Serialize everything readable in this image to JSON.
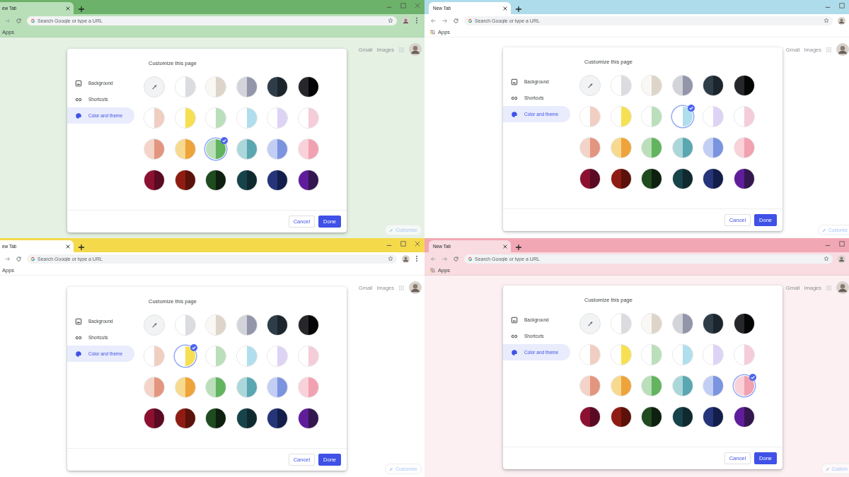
{
  "windows": [
    {
      "tab_title": "ew Tab",
      "omnibox": {
        "placeholder": "Search Google or type a URL"
      },
      "bookmark": {
        "label": "Apps",
        "kind": "plain"
      },
      "header_links": [
        "Gmail",
        "Images"
      ],
      "dialog": {
        "title": "Customize this page",
        "menu": [
          {
            "label": "Background",
            "kind": "background",
            "selected": false
          },
          {
            "label": "Shortcuts",
            "kind": "shortcuts",
            "selected": false
          },
          {
            "label": "Color and theme",
            "kind": "theme",
            "selected": true
          }
        ],
        "swatches": [
          {
            "kind": "picker",
            "color": "#f1f3f4",
            "selected": false
          },
          {
            "kind": "split",
            "halves": [
              {
                "color": "#ffffff"
              },
              {
                "color": "#dadce0"
              }
            ],
            "selected": false
          },
          {
            "kind": "split",
            "halves": [
              {
                "color": "#faf8f5"
              },
              {
                "color": "#ddd5c9"
              }
            ],
            "selected": false
          },
          {
            "kind": "split",
            "halves": [
              {
                "color": "#d3d4d9"
              },
              {
                "color": "#9395aa"
              }
            ],
            "selected": false
          },
          {
            "kind": "split",
            "halves": [
              {
                "color": "#2f3d48"
              },
              {
                "color": "#1c252c"
              }
            ],
            "selected": false
          },
          {
            "kind": "split",
            "halves": [
              {
                "color": "#26272a"
              },
              {
                "color": "#050505"
              }
            ],
            "selected": false
          },
          {
            "kind": "split",
            "halves": [
              {
                "color": "#ffffff"
              },
              {
                "color": "#f0cfc2"
              }
            ],
            "selected": false
          },
          {
            "kind": "split",
            "halves": [
              {
                "color": "#ffffff"
              },
              {
                "color": "#f6e052"
              }
            ],
            "selected": false
          },
          {
            "kind": "split",
            "halves": [
              {
                "color": "#ffffff"
              },
              {
                "color": "#badfba"
              }
            ],
            "selected": false
          },
          {
            "kind": "split",
            "halves": [
              {
                "color": "#ffffff"
              },
              {
                "color": "#b0deec"
              }
            ],
            "selected": false
          },
          {
            "kind": "split",
            "halves": [
              {
                "color": "#ffffff"
              },
              {
                "color": "#ddd3f5"
              }
            ],
            "selected": false
          },
          {
            "kind": "split",
            "halves": [
              {
                "color": "#ffffff"
              },
              {
                "color": "#f4cdd9"
              }
            ],
            "selected": false
          },
          {
            "kind": "split",
            "halves": [
              {
                "color": "#f4d4c8"
              },
              {
                "color": "#e3967f"
              }
            ],
            "selected": false
          },
          {
            "kind": "split",
            "halves": [
              {
                "color": "#f7da90"
              },
              {
                "color": "#eea33b"
              }
            ],
            "selected": false
          },
          {
            "kind": "split",
            "halves": [
              {
                "color": "#badfba"
              },
              {
                "color": "#62b45f"
              }
            ],
            "selected": true
          },
          {
            "kind": "split",
            "halves": [
              {
                "color": "#abd7da"
              },
              {
                "color": "#5ba7b1"
              }
            ],
            "selected": false
          },
          {
            "kind": "split",
            "halves": [
              {
                "color": "#c2cef4"
              },
              {
                "color": "#7b94df"
              }
            ],
            "selected": false
          },
          {
            "kind": "split",
            "halves": [
              {
                "color": "#f9d1d9"
              },
              {
                "color": "#f1a1b1"
              }
            ],
            "selected": false
          },
          {
            "kind": "split",
            "halves": [
              {
                "color": "#8c1131"
              },
              {
                "color": "#5b0a23"
              }
            ],
            "selected": false
          },
          {
            "kind": "split",
            "halves": [
              {
                "color": "#8f1c13"
              },
              {
                "color": "#5b120a"
              }
            ],
            "selected": false
          },
          {
            "kind": "split",
            "halves": [
              {
                "color": "#1f4b1f"
              },
              {
                "color": "#0e200f"
              }
            ],
            "selected": false
          },
          {
            "kind": "split",
            "halves": [
              {
                "color": "#17434a"
              },
              {
                "color": "#10292e"
              }
            ],
            "selected": false
          },
          {
            "kind": "split",
            "halves": [
              {
                "color": "#26357a"
              },
              {
                "color": "#131e4b"
              }
            ],
            "selected": false
          },
          {
            "kind": "split",
            "halves": [
              {
                "color": "#5f1d9b"
              },
              {
                "color": "#351750"
              }
            ],
            "selected": false
          }
        ],
        "buttons": [
          {
            "label": "Cancel",
            "kind": "secondary"
          },
          {
            "label": "Done",
            "kind": "primary"
          }
        ]
      },
      "customize_button": "Customize"
    },
    {
      "tab_title": "New Tab",
      "omnibox": {
        "placeholder": "Search Google or type a URL"
      },
      "bookmark": {
        "label": "Apps",
        "kind": "apps_icon"
      },
      "header_links": [
        "Gmail",
        "Images"
      ],
      "dialog": {
        "title": "Customize this page",
        "menu": [
          {
            "label": "Background",
            "kind": "background",
            "selected": false
          },
          {
            "label": "Shortcuts",
            "kind": "shortcuts",
            "selected": false
          },
          {
            "label": "Color and theme",
            "kind": "theme",
            "selected": true
          }
        ],
        "swatches": [
          {
            "kind": "picker",
            "color": "#f1f3f4",
            "selected": false
          },
          {
            "kind": "split",
            "halves": [
              {
                "color": "#ffffff"
              },
              {
                "color": "#dadce0"
              }
            ],
            "selected": false
          },
          {
            "kind": "split",
            "halves": [
              {
                "color": "#faf8f5"
              },
              {
                "color": "#ddd5c9"
              }
            ],
            "selected": false
          },
          {
            "kind": "split",
            "halves": [
              {
                "color": "#d3d4d9"
              },
              {
                "color": "#9395aa"
              }
            ],
            "selected": false
          },
          {
            "kind": "split",
            "halves": [
              {
                "color": "#2f3d48"
              },
              {
                "color": "#1c252c"
              }
            ],
            "selected": false
          },
          {
            "kind": "split",
            "halves": [
              {
                "color": "#26272a"
              },
              {
                "color": "#050505"
              }
            ],
            "selected": false
          },
          {
            "kind": "split",
            "halves": [
              {
                "color": "#ffffff"
              },
              {
                "color": "#f0cfc2"
              }
            ],
            "selected": false
          },
          {
            "kind": "split",
            "halves": [
              {
                "color": "#ffffff"
              },
              {
                "color": "#f6e052"
              }
            ],
            "selected": false
          },
          {
            "kind": "split",
            "halves": [
              {
                "color": "#ffffff"
              },
              {
                "color": "#badfba"
              }
            ],
            "selected": false
          },
          {
            "kind": "split",
            "halves": [
              {
                "color": "#ffffff"
              },
              {
                "color": "#b0deec"
              }
            ],
            "selected": true
          },
          {
            "kind": "split",
            "halves": [
              {
                "color": "#ffffff"
              },
              {
                "color": "#ddd3f5"
              }
            ],
            "selected": false
          },
          {
            "kind": "split",
            "halves": [
              {
                "color": "#ffffff"
              },
              {
                "color": "#f4cdd9"
              }
            ],
            "selected": false
          },
          {
            "kind": "split",
            "halves": [
              {
                "color": "#f4d4c8"
              },
              {
                "color": "#e3967f"
              }
            ],
            "selected": false
          },
          {
            "kind": "split",
            "halves": [
              {
                "color": "#f7da90"
              },
              {
                "color": "#eea33b"
              }
            ],
            "selected": false
          },
          {
            "kind": "split",
            "halves": [
              {
                "color": "#badfba"
              },
              {
                "color": "#62b45f"
              }
            ],
            "selected": false
          },
          {
            "kind": "split",
            "halves": [
              {
                "color": "#abd7da"
              },
              {
                "color": "#5ba7b1"
              }
            ],
            "selected": false
          },
          {
            "kind": "split",
            "halves": [
              {
                "color": "#c2cef4"
              },
              {
                "color": "#7b94df"
              }
            ],
            "selected": false
          },
          {
            "kind": "split",
            "halves": [
              {
                "color": "#f9d1d9"
              },
              {
                "color": "#f1a1b1"
              }
            ],
            "selected": false
          },
          {
            "kind": "split",
            "halves": [
              {
                "color": "#8c1131"
              },
              {
                "color": "#5b0a23"
              }
            ],
            "selected": false
          },
          {
            "kind": "split",
            "halves": [
              {
                "color": "#8f1c13"
              },
              {
                "color": "#5b120a"
              }
            ],
            "selected": false
          },
          {
            "kind": "split",
            "halves": [
              {
                "color": "#1f4b1f"
              },
              {
                "color": "#0e200f"
              }
            ],
            "selected": false
          },
          {
            "kind": "split",
            "halves": [
              {
                "color": "#17434a"
              },
              {
                "color": "#10292e"
              }
            ],
            "selected": false
          },
          {
            "kind": "split",
            "halves": [
              {
                "color": "#26357a"
              },
              {
                "color": "#131e4b"
              }
            ],
            "selected": false
          },
          {
            "kind": "split",
            "halves": [
              {
                "color": "#5f1d9b"
              },
              {
                "color": "#351750"
              }
            ],
            "selected": false
          }
        ],
        "buttons": [
          {
            "label": "Cancel",
            "kind": "secondary"
          },
          {
            "label": "Done",
            "kind": "primary"
          }
        ]
      },
      "customize_button": "Customiz"
    },
    {
      "tab_title": "ew Tab",
      "omnibox": {
        "placeholder": "Search Google or type a URL"
      },
      "bookmark": {
        "label": "Apps",
        "kind": "plain"
      },
      "header_links": [
        "Gmail",
        "Images"
      ],
      "dialog": {
        "title": "Customize this page",
        "menu": [
          {
            "label": "Background",
            "kind": "background",
            "selected": false
          },
          {
            "label": "Shortcuts",
            "kind": "shortcuts",
            "selected": false
          },
          {
            "label": "Color and theme",
            "kind": "theme",
            "selected": true
          }
        ],
        "swatches": [
          {
            "kind": "picker",
            "color": "#f1f3f4",
            "selected": false
          },
          {
            "kind": "split",
            "halves": [
              {
                "color": "#ffffff"
              },
              {
                "color": "#dadce0"
              }
            ],
            "selected": false
          },
          {
            "kind": "split",
            "halves": [
              {
                "color": "#faf8f5"
              },
              {
                "color": "#ddd5c9"
              }
            ],
            "selected": false
          },
          {
            "kind": "split",
            "halves": [
              {
                "color": "#d3d4d9"
              },
              {
                "color": "#9395aa"
              }
            ],
            "selected": false
          },
          {
            "kind": "split",
            "halves": [
              {
                "color": "#2f3d48"
              },
              {
                "color": "#1c252c"
              }
            ],
            "selected": false
          },
          {
            "kind": "split",
            "halves": [
              {
                "color": "#26272a"
              },
              {
                "color": "#050505"
              }
            ],
            "selected": false
          },
          {
            "kind": "split",
            "halves": [
              {
                "color": "#ffffff"
              },
              {
                "color": "#f0cfc2"
              }
            ],
            "selected": false
          },
          {
            "kind": "split",
            "halves": [
              {
                "color": "#ffffff"
              },
              {
                "color": "#f6e052"
              }
            ],
            "selected": true
          },
          {
            "kind": "split",
            "halves": [
              {
                "color": "#ffffff"
              },
              {
                "color": "#badfba"
              }
            ],
            "selected": false
          },
          {
            "kind": "split",
            "halves": [
              {
                "color": "#ffffff"
              },
              {
                "color": "#b0deec"
              }
            ],
            "selected": false
          },
          {
            "kind": "split",
            "halves": [
              {
                "color": "#ffffff"
              },
              {
                "color": "#ddd3f5"
              }
            ],
            "selected": false
          },
          {
            "kind": "split",
            "halves": [
              {
                "color": "#ffffff"
              },
              {
                "color": "#f4cdd9"
              }
            ],
            "selected": false
          },
          {
            "kind": "split",
            "halves": [
              {
                "color": "#f4d4c8"
              },
              {
                "color": "#e3967f"
              }
            ],
            "selected": false
          },
          {
            "kind": "split",
            "halves": [
              {
                "color": "#f7da90"
              },
              {
                "color": "#eea33b"
              }
            ],
            "selected": false
          },
          {
            "kind": "split",
            "halves": [
              {
                "color": "#badfba"
              },
              {
                "color": "#62b45f"
              }
            ],
            "selected": false
          },
          {
            "kind": "split",
            "halves": [
              {
                "color": "#abd7da"
              },
              {
                "color": "#5ba7b1"
              }
            ],
            "selected": false
          },
          {
            "kind": "split",
            "halves": [
              {
                "color": "#c2cef4"
              },
              {
                "color": "#7b94df"
              }
            ],
            "selected": false
          },
          {
            "kind": "split",
            "halves": [
              {
                "color": "#f9d1d9"
              },
              {
                "color": "#f1a1b1"
              }
            ],
            "selected": false
          },
          {
            "kind": "split",
            "halves": [
              {
                "color": "#8c1131"
              },
              {
                "color": "#5b0a23"
              }
            ],
            "selected": false
          },
          {
            "kind": "split",
            "halves": [
              {
                "color": "#8f1c13"
              },
              {
                "color": "#5b120a"
              }
            ],
            "selected": false
          },
          {
            "kind": "split",
            "halves": [
              {
                "color": "#1f4b1f"
              },
              {
                "color": "#0e200f"
              }
            ],
            "selected": false
          },
          {
            "kind": "split",
            "halves": [
              {
                "color": "#17434a"
              },
              {
                "color": "#10292e"
              }
            ],
            "selected": false
          },
          {
            "kind": "split",
            "halves": [
              {
                "color": "#26357a"
              },
              {
                "color": "#131e4b"
              }
            ],
            "selected": false
          },
          {
            "kind": "split",
            "halves": [
              {
                "color": "#5f1d9b"
              },
              {
                "color": "#351750"
              }
            ],
            "selected": false
          }
        ],
        "buttons": [
          {
            "label": "Cancel",
            "kind": "secondary"
          },
          {
            "label": "Done",
            "kind": "primary"
          }
        ]
      },
      "customize_button": "Customize"
    },
    {
      "tab_title": "New Tab",
      "omnibox": {
        "placeholder": "Search Google or type a URL"
      },
      "bookmark": {
        "label": "Apps",
        "kind": "apps_icon"
      },
      "header_links": [
        "Gmail",
        "Images"
      ],
      "dialog": {
        "title": "Customize this page",
        "menu": [
          {
            "label": "Background",
            "kind": "background",
            "selected": false
          },
          {
            "label": "Shortcuts",
            "kind": "shortcuts",
            "selected": false
          },
          {
            "label": "Color and theme",
            "kind": "theme",
            "selected": true
          }
        ],
        "swatches": [
          {
            "kind": "picker",
            "color": "#f1f3f4",
            "selected": false
          },
          {
            "kind": "split",
            "halves": [
              {
                "color": "#ffffff"
              },
              {
                "color": "#dadce0"
              }
            ],
            "selected": false
          },
          {
            "kind": "split",
            "halves": [
              {
                "color": "#faf8f5"
              },
              {
                "color": "#ddd5c9"
              }
            ],
            "selected": false
          },
          {
            "kind": "split",
            "halves": [
              {
                "color": "#d3d4d9"
              },
              {
                "color": "#9395aa"
              }
            ],
            "selected": false
          },
          {
            "kind": "split",
            "halves": [
              {
                "color": "#2f3d48"
              },
              {
                "color": "#1c252c"
              }
            ],
            "selected": false
          },
          {
            "kind": "split",
            "halves": [
              {
                "color": "#26272a"
              },
              {
                "color": "#050505"
              }
            ],
            "selected": false
          },
          {
            "kind": "split",
            "halves": [
              {
                "color": "#ffffff"
              },
              {
                "color": "#f0cfc2"
              }
            ],
            "selected": false
          },
          {
            "kind": "split",
            "halves": [
              {
                "color": "#ffffff"
              },
              {
                "color": "#f6e052"
              }
            ],
            "selected": false
          },
          {
            "kind": "split",
            "halves": [
              {
                "color": "#ffffff"
              },
              {
                "color": "#badfba"
              }
            ],
            "selected": false
          },
          {
            "kind": "split",
            "halves": [
              {
                "color": "#ffffff"
              },
              {
                "color": "#b0deec"
              }
            ],
            "selected": false
          },
          {
            "kind": "split",
            "halves": [
              {
                "color": "#ffffff"
              },
              {
                "color": "#ddd3f5"
              }
            ],
            "selected": false
          },
          {
            "kind": "split",
            "halves": [
              {
                "color": "#ffffff"
              },
              {
                "color": "#f4cdd9"
              }
            ],
            "selected": false
          },
          {
            "kind": "split",
            "halves": [
              {
                "color": "#f4d4c8"
              },
              {
                "color": "#e3967f"
              }
            ],
            "selected": false
          },
          {
            "kind": "split",
            "halves": [
              {
                "color": "#f7da90"
              },
              {
                "color": "#eea33b"
              }
            ],
            "selected": false
          },
          {
            "kind": "split",
            "halves": [
              {
                "color": "#badfba"
              },
              {
                "color": "#62b45f"
              }
            ],
            "selected": false
          },
          {
            "kind": "split",
            "halves": [
              {
                "color": "#abd7da"
              },
              {
                "color": "#5ba7b1"
              }
            ],
            "selected": false
          },
          {
            "kind": "split",
            "halves": [
              {
                "color": "#c2cef4"
              },
              {
                "color": "#7b94df"
              }
            ],
            "selected": false
          },
          {
            "kind": "split",
            "halves": [
              {
                "color": "#f9d1d9"
              },
              {
                "color": "#f1a1b1"
              }
            ],
            "selected": true
          },
          {
            "kind": "split",
            "halves": [
              {
                "color": "#8c1131"
              },
              {
                "color": "#5b0a23"
              }
            ],
            "selected": false
          },
          {
            "kind": "split",
            "halves": [
              {
                "color": "#8f1c13"
              },
              {
                "color": "#5b120a"
              }
            ],
            "selected": false
          },
          {
            "kind": "split",
            "halves": [
              {
                "color": "#1f4b1f"
              },
              {
                "color": "#0e200f"
              }
            ],
            "selected": false
          },
          {
            "kind": "split",
            "halves": [
              {
                "color": "#17434a"
              },
              {
                "color": "#10292e"
              }
            ],
            "selected": false
          },
          {
            "kind": "split",
            "halves": [
              {
                "color": "#26357a"
              },
              {
                "color": "#131e4b"
              }
            ],
            "selected": false
          },
          {
            "kind": "split",
            "halves": [
              {
                "color": "#5f1d9b"
              },
              {
                "color": "#351750"
              }
            ],
            "selected": false
          }
        ],
        "buttons": [
          {
            "label": "Cancel",
            "kind": "secondary"
          },
          {
            "label": "Done",
            "kind": "primary"
          }
        ]
      },
      "customize_button": "Custom"
    }
  ]
}
